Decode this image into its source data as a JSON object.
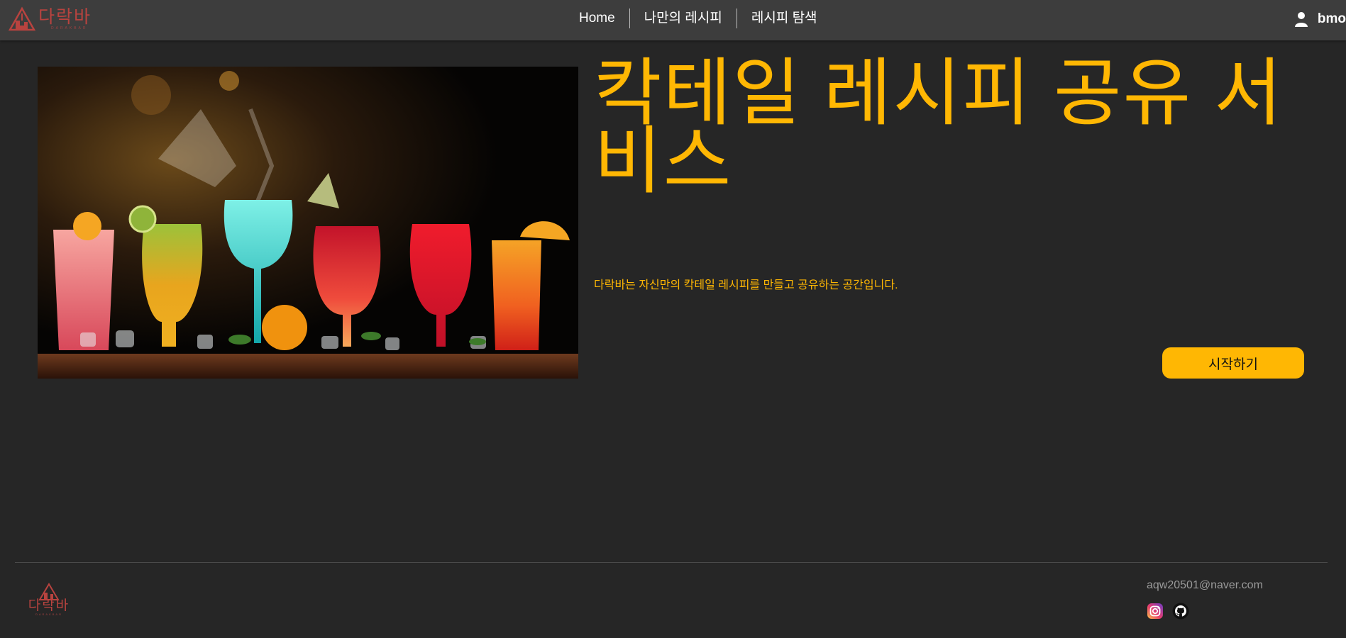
{
  "header": {
    "logo": {
      "text": "다락바",
      "subtext": "DARAKBAR"
    },
    "nav": [
      {
        "label": "Home"
      },
      {
        "label": "나만의 레시피"
      },
      {
        "label": "레시피 탐색"
      }
    ],
    "user": {
      "icon": "user-icon",
      "name": "bmo"
    }
  },
  "hero": {
    "image": "cocktail-glasses-photo",
    "title": "칵테일 레시피 공유 서비스",
    "description": "다락바는 자신만의 칵테일 레시피를 만들고 공유하는 공간입니다.",
    "cta_label": "시작하기"
  },
  "footer": {
    "logo": {
      "text": "다락바",
      "subtext": "DARAKBAR"
    },
    "email": "aqw20501@naver.com",
    "social_icons": [
      "instagram-icon",
      "github-icon"
    ]
  },
  "colors": {
    "accent": "#ffb703",
    "background": "#262626",
    "header": "#3d3d3d",
    "logo": "#b8433f"
  }
}
